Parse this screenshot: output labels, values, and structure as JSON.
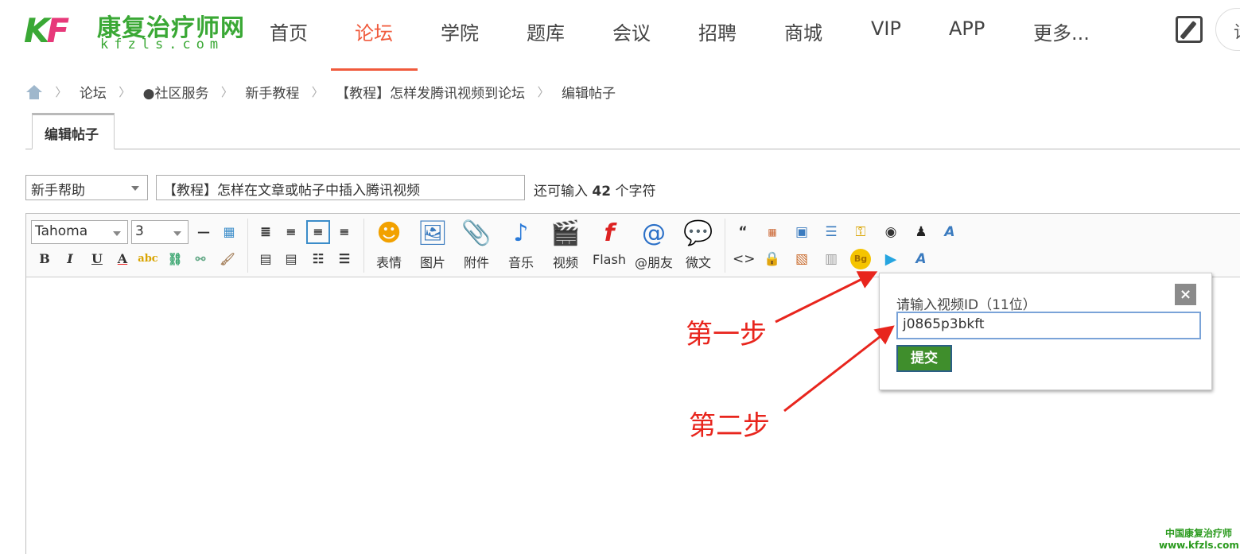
{
  "logo": {
    "brand_cn": "康复治疗师网",
    "brand_en": "kfzls.com",
    "mark": "KF"
  },
  "nav": {
    "items": [
      "首页",
      "论坛",
      "学院",
      "题库",
      "会议",
      "招聘",
      "商城",
      "VIP",
      "APP",
      "更多..."
    ],
    "active": "论坛",
    "login": "请"
  },
  "breadcrumb": [
    "论坛",
    "●社区服务",
    "新手教程",
    "【教程】怎样发腾讯视频到论坛",
    "编辑帖子"
  ],
  "tab": {
    "label": "编辑帖子"
  },
  "form": {
    "category": "新手帮助",
    "subject": "【教程】怎样在文章或帖子中插入腾讯视频",
    "remain_prefix": "还可输入",
    "remain_count": "42",
    "remain_suffix": "个字符"
  },
  "toolbar": {
    "font": "Tahoma",
    "size": "3",
    "big_buttons": [
      "表情",
      "图片",
      "附件",
      "音乐",
      "视频",
      "Flash",
      "@朋友",
      "微文"
    ]
  },
  "popup": {
    "label": "请输入视频ID（11位）",
    "value": "j0865p3bkft",
    "submit": "提交",
    "close": "×"
  },
  "annotations": {
    "step1": "第一步",
    "step2": "第二步"
  },
  "watermark": {
    "line1": "中国康复治疗师",
    "line2": "www.kfzls.com"
  },
  "colors": {
    "accent": "#f05a3c",
    "brand_green": "#3aa835",
    "submit_green": "#3f8e2c",
    "annotation_red": "#e8251d"
  }
}
